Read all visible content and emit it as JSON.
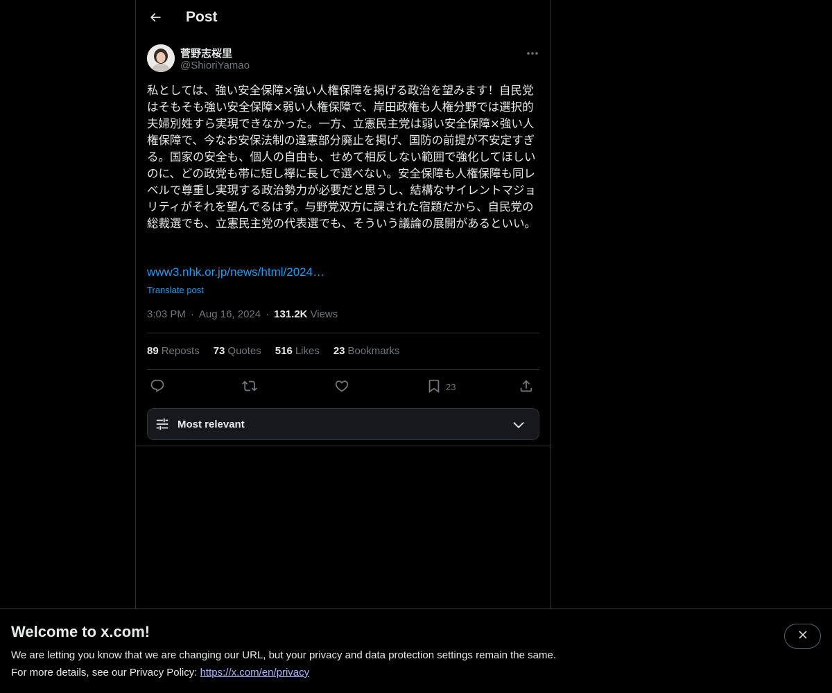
{
  "header": {
    "title": "Post"
  },
  "author": {
    "name": "菅野志桜里",
    "handle": "@ShioriYamao"
  },
  "post": {
    "text": "私としては、強い安全保障×強い人権保障を掲げる政治を望みます！自民党はそもそも強い安全保障×弱い人権保障で、岸田政権も人権分野では選択的夫婦別姓すら実現できなかった。一方、立憲民主党は弱い安全保障×強い人権保障で、今なお安保法制の違憲部分廃止を掲げ、国防の前提が不安定すぎる。国家の安全も、個人の自由も、せめて相反しない範囲で強化してほしいのに、どの政党も帯に短し襷に長しで選べない。安全保障も人権保障も同レベルで尊重し実現する政治勢力が必要だと思うし、結構なサイレントマジョリティがそれを望んでるはず。与野党双方に課された宿題だから、自民党の総裁選でも、立憲民主党の代表選でも、そういう議論の展開があるといい。",
    "link": "www3.nhk.or.jp/news/html/2024…",
    "translate": "Translate post",
    "time": "3:03 PM",
    "date": "Aug 16, 2024",
    "views_count": "131.2K",
    "views_label": "Views",
    "separator": "·"
  },
  "stats": [
    {
      "count": "89",
      "label": "Reposts"
    },
    {
      "count": "73",
      "label": "Quotes"
    },
    {
      "count": "516",
      "label": "Likes"
    },
    {
      "count": "23",
      "label": "Bookmarks"
    }
  ],
  "actions": {
    "reply_icon": "reply-icon",
    "repost_icon": "repost-icon",
    "like_icon": "heart-icon",
    "bookmark_icon": "bookmark-icon",
    "bookmark_count": "23",
    "share_icon": "share-icon"
  },
  "sort": {
    "label": "Most relevant"
  },
  "banner": {
    "title": "Welcome to x.com!",
    "line1": "We are letting you know that we are changing our URL, but your privacy and data protection settings remain the same.",
    "line2_prefix": "For more details, see our Privacy Policy: ",
    "line2_link": "https://x.com/en/privacy"
  },
  "colors": {
    "background": "#000000",
    "text": "#e7e9ea",
    "muted": "#71767b",
    "accent": "#1d9bf0",
    "border": "#2f3336"
  }
}
